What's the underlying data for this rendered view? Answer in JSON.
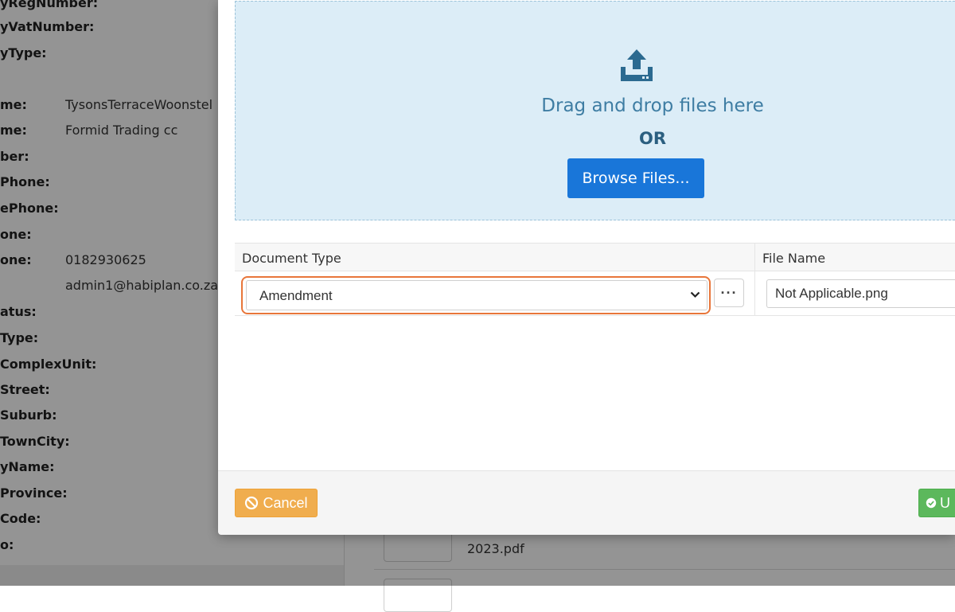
{
  "background": {
    "fields": [
      {
        "label": "yRegNumber:",
        "value": ""
      },
      {
        "label": "yVatNumber:",
        "value": ""
      },
      {
        "label": "yType:",
        "value": ""
      },
      {
        "label": "me:",
        "value": "TysonsTerraceWoonstel"
      },
      {
        "label": "me:",
        "value": "Formid Trading cc"
      },
      {
        "label": "ber:",
        "value": ""
      },
      {
        "label": "Phone:",
        "value": ""
      },
      {
        "label": "ePhone:",
        "value": ""
      },
      {
        "label": "one:",
        "value": ""
      },
      {
        "label": "one:",
        "value": "0182930625"
      },
      {
        "label": "",
        "value": "admin1@habiplan.co.za"
      },
      {
        "label": "atus:",
        "value": ""
      },
      {
        "label": "Type:",
        "value": ""
      },
      {
        "label": "ComplexUnit:",
        "value": ""
      },
      {
        "label": "Street:",
        "value": ""
      },
      {
        "label": "Suburb:",
        "value": ""
      },
      {
        "label": "TownCity:",
        "value": ""
      },
      {
        "label": "yName:",
        "value": ""
      },
      {
        "label": "Province:",
        "value": ""
      },
      {
        "label": "Code:",
        "value": ""
      },
      {
        "label": "o:",
        "value": ""
      }
    ],
    "file_rows": [
      {
        "name": "2023.pdf"
      }
    ]
  },
  "modal": {
    "dropzone": {
      "icon": "upload-icon",
      "drag_text": "Drag and drop files here",
      "or_text": "OR",
      "browse_label": "Browse Files..."
    },
    "table": {
      "headers": {
        "document_type": "Document Type",
        "file_name": "File Name"
      },
      "row": {
        "document_type": "Amendment",
        "more_label": "···",
        "file_name": "Not Applicable.png"
      }
    },
    "footer": {
      "cancel_label": "Cancel",
      "upload_label": "U"
    }
  },
  "colors": {
    "accent": "#1976d9",
    "cancel": "#f0ad4e",
    "upload": "#5cb85c",
    "highlight": "#e8763a",
    "dropzone_bg": "#dcedf7"
  }
}
